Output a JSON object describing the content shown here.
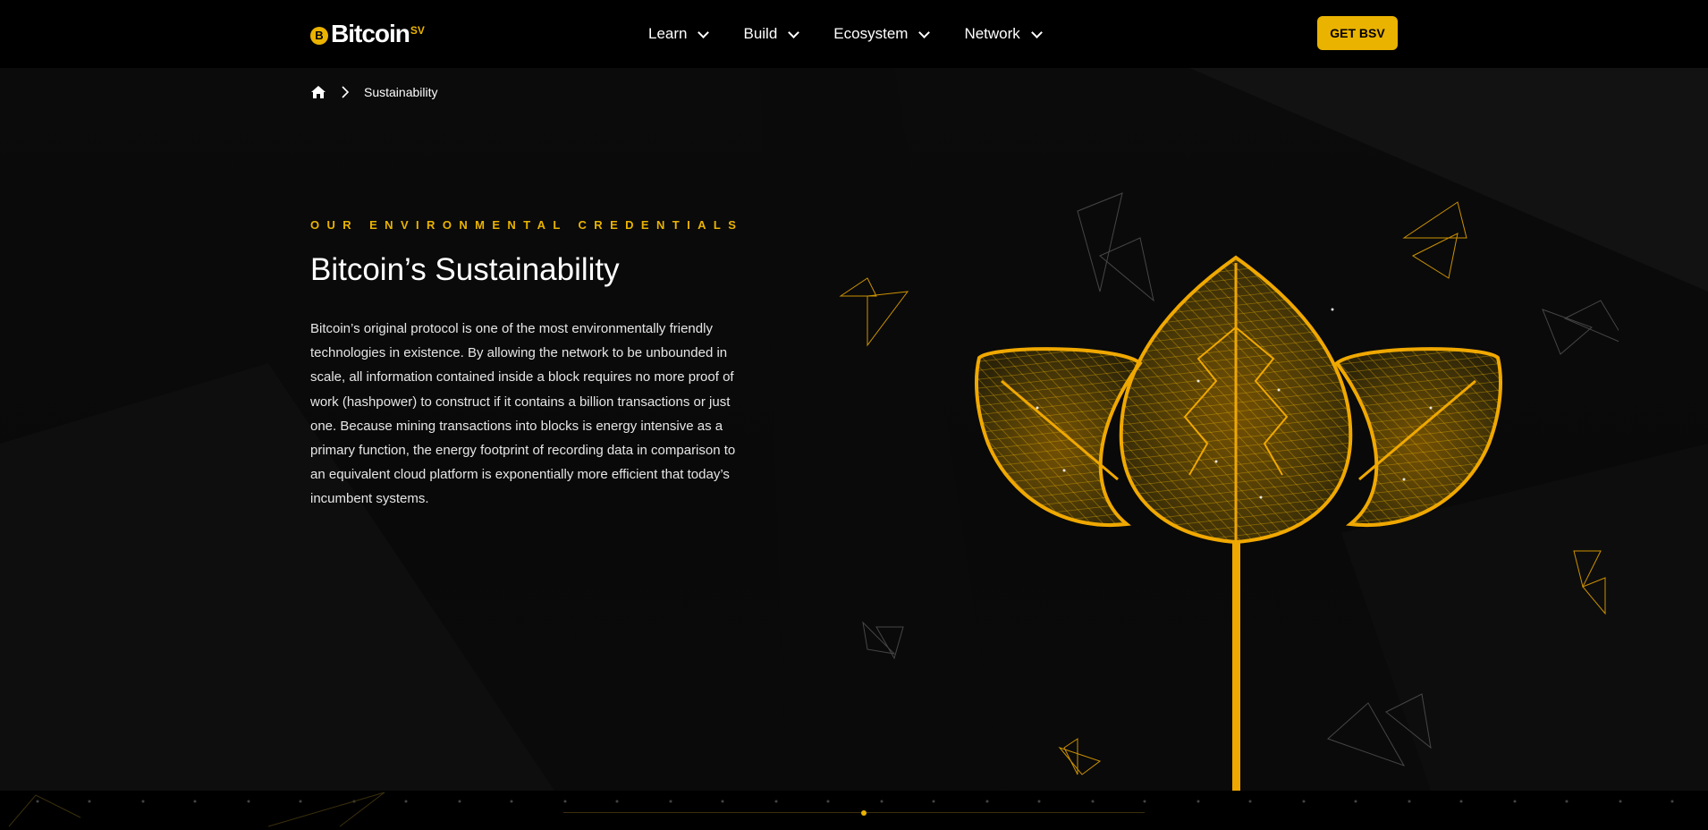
{
  "header": {
    "logo": {
      "word": "Bitcoin",
      "suffix": "SV",
      "coin_glyph": "B"
    },
    "nav": [
      {
        "label": "Learn",
        "icon": "chevron-down-icon"
      },
      {
        "label": "Build",
        "icon": "chevron-down-icon"
      },
      {
        "label": "Ecosystem",
        "icon": "chevron-down-icon"
      },
      {
        "label": "Network",
        "icon": "chevron-down-icon"
      }
    ],
    "cta_label": "GET BSV"
  },
  "breadcrumb": {
    "home_icon": "home-icon",
    "separator_icon": "chevron-right-icon",
    "current": "Sustainability"
  },
  "hero": {
    "eyebrow": "OUR ENVIRONMENTAL CREDENTIALS",
    "title": "Bitcoin’s Sustainability",
    "body": "Bitcoin’s original protocol is one of the most environmentally friendly technologies in existence. By allowing the network to be unbounded in scale, all information contained inside a block requires no more proof of work (hashpower) to construct if it contains a billion transactions or just one. Because mining transactions into blocks is energy intensive as a primary function, the energy footprint of recording data in comparison to an equivalent cloud platform is exponentially more efficient that today’s incumbent systems.",
    "illustration": "golden-low-poly-leaves-icon"
  },
  "colors": {
    "accent": "#eab300",
    "background": "#060606",
    "header_bg": "#000000",
    "text": "#ffffff"
  }
}
